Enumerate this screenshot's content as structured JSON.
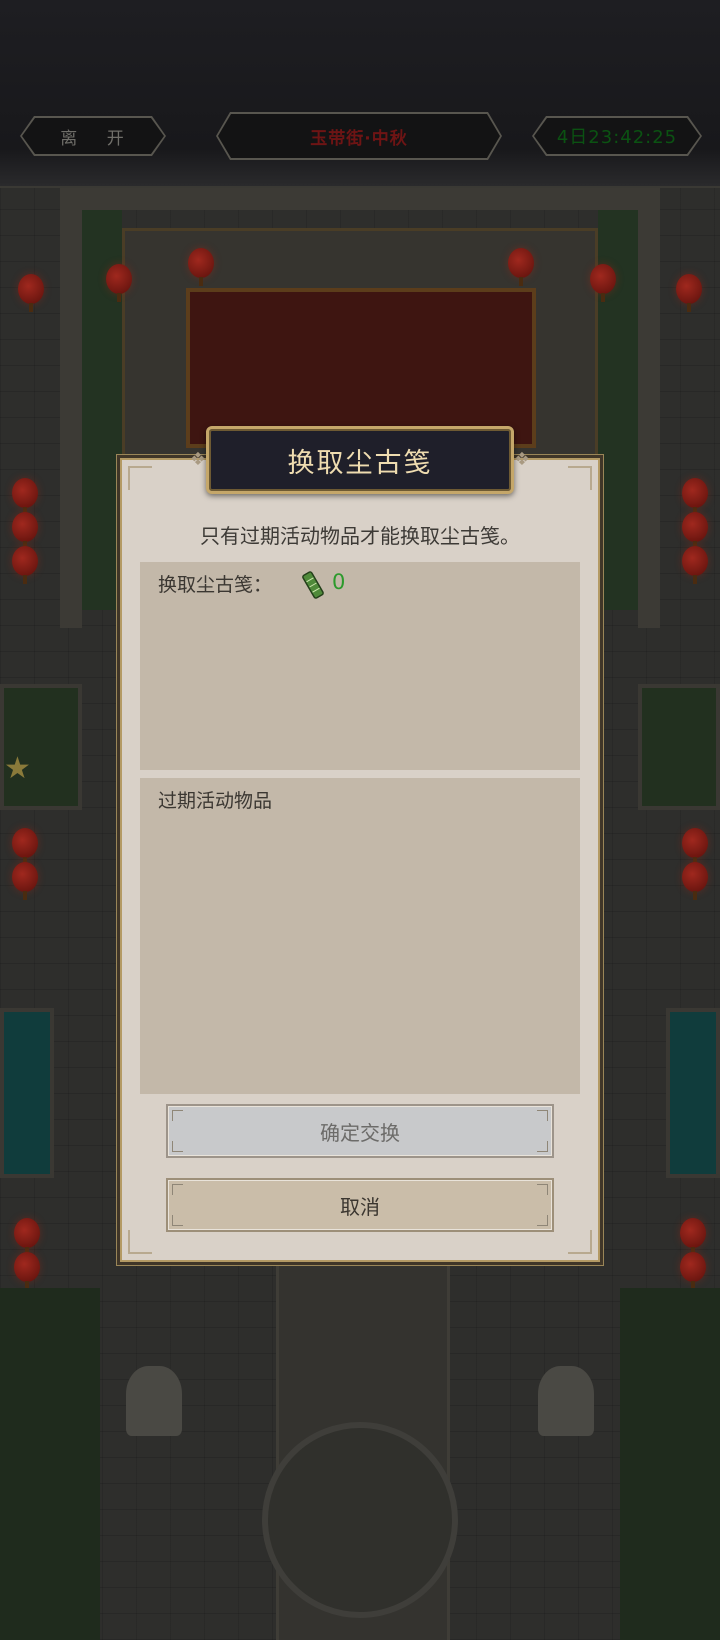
{
  "header": {
    "leave_label": "离 开",
    "location": "玉带街·中秋",
    "timer": "4日23:42:25"
  },
  "dialog": {
    "title": "换取尘古笺",
    "notice": "只有过期活动物品才能换取尘古笺。",
    "exchange_label": "换取尘古笺：",
    "exchange_count": "0",
    "expired_label": "过期活动物品",
    "confirm_label": "确定交换",
    "cancel_label": "取消"
  },
  "icons": {
    "item": "bamboo-slip-icon"
  },
  "colors": {
    "count_green": "#2c9a2c",
    "title_gold": "#efdcb0",
    "dialog_bg": "#d9d1c8",
    "panel_bg": "#c3b8a9"
  }
}
